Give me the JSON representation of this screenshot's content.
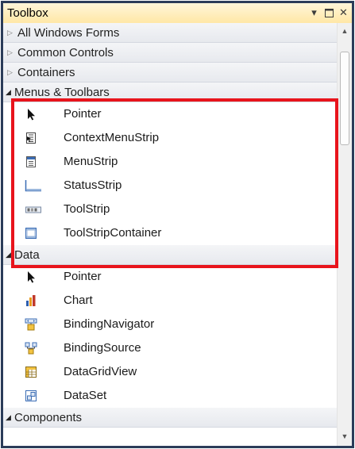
{
  "window": {
    "title": "Toolbox",
    "dropdown_icon": "chevron-down-icon",
    "maximize_icon": "maximize-icon",
    "close_icon": "close-icon"
  },
  "categories": [
    {
      "label": "All Windows Forms",
      "expanded": false
    },
    {
      "label": "Common Controls",
      "expanded": false
    },
    {
      "label": "Containers",
      "expanded": false
    },
    {
      "label": "Menus & Toolbars",
      "expanded": true,
      "items": [
        {
          "label": "Pointer",
          "icon": "pointer-icon"
        },
        {
          "label": "ContextMenuStrip",
          "icon": "context-menu-strip-icon"
        },
        {
          "label": "MenuStrip",
          "icon": "menu-strip-icon"
        },
        {
          "label": "StatusStrip",
          "icon": "status-strip-icon"
        },
        {
          "label": "ToolStrip",
          "icon": "tool-strip-icon"
        },
        {
          "label": "ToolStripContainer",
          "icon": "tool-strip-container-icon"
        }
      ]
    },
    {
      "label": "Data",
      "expanded": true,
      "items": [
        {
          "label": "Pointer",
          "icon": "pointer-icon"
        },
        {
          "label": "Chart",
          "icon": "chart-icon"
        },
        {
          "label": "BindingNavigator",
          "icon": "binding-navigator-icon"
        },
        {
          "label": "BindingSource",
          "icon": "binding-source-icon"
        },
        {
          "label": "DataGridView",
          "icon": "data-grid-view-icon"
        },
        {
          "label": "DataSet",
          "icon": "dataset-icon"
        }
      ]
    },
    {
      "label": "Components",
      "expanded": true
    }
  ],
  "highlight": {
    "color": "#e8141c",
    "target": "Menus & Toolbars"
  },
  "colors": {
    "frame": "#2b3c59",
    "title_bar": "#ffe7a6"
  }
}
